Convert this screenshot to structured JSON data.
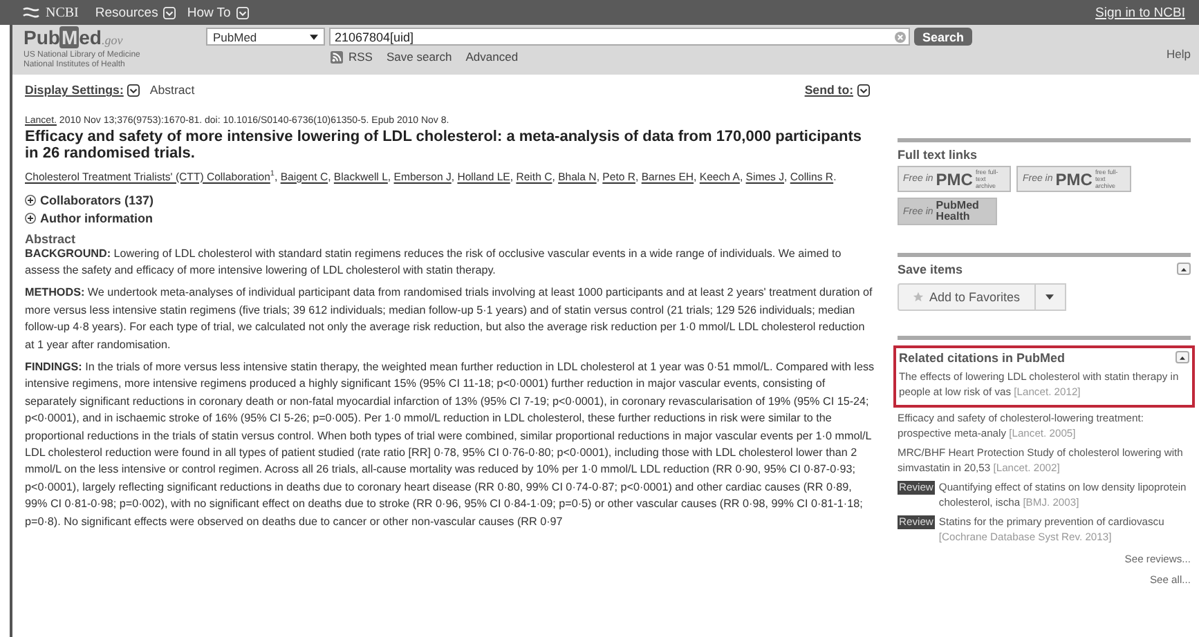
{
  "top_bar": {
    "brand": "NCBI",
    "menus": [
      "Resources",
      "How To"
    ],
    "sign_in": "Sign in to NCBI"
  },
  "header": {
    "logo": {
      "pub": "Pub",
      "m": "M",
      "ed": "ed",
      "gov": ".gov"
    },
    "tagline": "US National Library of Medicine National Institutes of Health",
    "database": "PubMed",
    "query": "21067804[uid]",
    "search_button": "Search",
    "links": [
      {
        "kind": "rss",
        "label": "RSS"
      },
      {
        "kind": "plain",
        "label": "Save search"
      },
      {
        "kind": "plain",
        "label": "Advanced"
      }
    ],
    "help": "Help"
  },
  "display": {
    "settings_label": "Display Settings:",
    "format": "Abstract",
    "send_to": "Send to:"
  },
  "article": {
    "journal": "Lancet.",
    "citation": "2010 Nov 13;376(9753):1670-81. doi: 10.1016/S0140-6736(10)61350-5. Epub 2010 Nov 8.",
    "title": "Efficacy and safety of more intensive lowering of LDL cholesterol: a meta-analysis of data from 170,000 participants in 26 randomised trials.",
    "authors": [
      {
        "name": "Cholesterol Treatment Trialists' (CTT) Collaboration",
        "sup": "1",
        "after": ","
      },
      {
        "name": "Baigent C",
        "after": ","
      },
      {
        "name": "Blackwell L",
        "after": ","
      },
      {
        "name": "Emberson J",
        "after": ","
      },
      {
        "name": "Holland LE",
        "after": ","
      },
      {
        "name": "Reith C",
        "after": ","
      },
      {
        "name": "Bhala N",
        "after": ","
      },
      {
        "name": "Peto R",
        "after": ","
      },
      {
        "name": "Barnes EH",
        "after": ","
      },
      {
        "name": "Keech A",
        "after": ","
      },
      {
        "name": "Simes J",
        "after": ","
      },
      {
        "name": "Collins R",
        "after": "."
      }
    ],
    "sections": [
      {
        "label": "Collaborators (137)",
        "expanded": false
      },
      {
        "label": "Author information",
        "expanded": false
      }
    ],
    "abstract_heading": "Abstract",
    "abstract": [
      "**BACKGROUND:** Lowering of LDL cholesterol with standard statin regimens reduces the risk of occlusive vascular events in a wide range of individuals. We aimed to assess the safety and efficacy of more intensive lowering of LDL cholesterol with statin therapy.",
      "**METHODS:** We undertook meta-analyses of individual participant data from randomised trials involving at least 1000 participants and at least 2 years' treatment duration of more versus less intensive statin regimens (five trials; 39 612 individuals; median follow-up 5·1 years) and of statin versus control (21 trials; 129 526 individuals; median follow-up 4·8 years). For each type of trial, we calculated not only the average risk reduction, but also the average risk reduction per 1·0 mmol/L LDL cholesterol reduction at 1 year after randomisation.",
      "**FINDINGS:** In the trials of more versus less intensive statin therapy, the weighted mean further reduction in LDL cholesterol at 1 year was 0·51 mmol/L. Compared with less intensive regimens, more intensive regimens produced a highly significant 15% (95% CI 11-18; p<0·0001) further reduction in major vascular events, consisting of separately significant reductions in coronary death or non-fatal myocardial infarction of 13% (95% CI 7-19; p<0·0001), in coronary revascularisation of 19% (95% CI 15-24; p<0·0001), and in ischaemic stroke of 16% (95% CI 5-26; p=0·005). Per 1·0 mmol/L reduction in LDL cholesterol, these further reductions in risk were similar to the proportional reductions in the trials of statin versus control. When both types of trial were combined, similar proportional reductions in major vascular events per 1·0 mmol/L LDL cholesterol reduction were found in all types of patient studied (rate ratio [RR] 0·78, 95% CI 0·76-0·80; p<0·0001), including those with LDL cholesterol lower than 2 mmol/L on the less intensive or control regimen. Across all 26 trials, all-cause mortality was reduced by 10% per 1·0 mmol/L LDL reduction (RR 0·90, 95% CI 0·87-0·93; p<0·0001), largely reflecting significant reductions in deaths due to coronary heart disease (RR 0·80, 99% CI 0·74-0·87; p<0·0001) and other cardiac causes (RR 0·89, 99% CI 0·81-0·98; p=0·002), with no significant effect on deaths due to stroke (RR 0·96, 95% CI 0·84-1·09; p=0·5) or other vascular causes (RR 0·98, 99% CI 0·81-1·18; p=0·8). No significant effects were observed on deaths due to cancer or other non-vascular causes (RR 0·97"
    ]
  },
  "sidebar": {
    "full_text": {
      "heading": "Full text links",
      "links": [
        {
          "kind": "pmc",
          "prefix": "Free in",
          "brand": "PMC",
          "note": "free full-text archive"
        },
        {
          "kind": "pmc",
          "prefix": "Free in",
          "brand": "PMC",
          "note": "free full-text archive"
        },
        {
          "kind": "health",
          "prefix": "Free in",
          "brand": "PubMed Health"
        }
      ]
    },
    "save": {
      "heading": "Save items",
      "button": "Add to Favorites",
      "expanded": true
    },
    "related": {
      "heading": "Related citations in PubMed",
      "expanded": true,
      "highlighted": true,
      "items": [
        {
          "review": false,
          "title": "The effects of lowering LDL cholesterol with statin therapy in people at low risk of vas",
          "source": "[Lancet. 2012]"
        },
        {
          "review": false,
          "title": "Efficacy and safety of cholesterol-lowering treatment: prospective meta-analy",
          "source": "[Lancet. 2005]"
        },
        {
          "review": false,
          "title": "MRC/BHF Heart Protection Study of cholesterol lowering with simvastatin in 20,53",
          "source": "[Lancet. 2002]"
        },
        {
          "review": true,
          "badge": "Review",
          "title": "Quantifying effect of statins on low density lipoprotein cholesterol, ischa",
          "source": "[BMJ. 2003]"
        },
        {
          "review": true,
          "badge": "Review",
          "title": "Statins for the primary prevention of cardiovascu",
          "source": "[Cochrane Database Syst Rev. 2013]"
        }
      ],
      "links": [
        "See reviews...",
        "See all..."
      ]
    }
  }
}
